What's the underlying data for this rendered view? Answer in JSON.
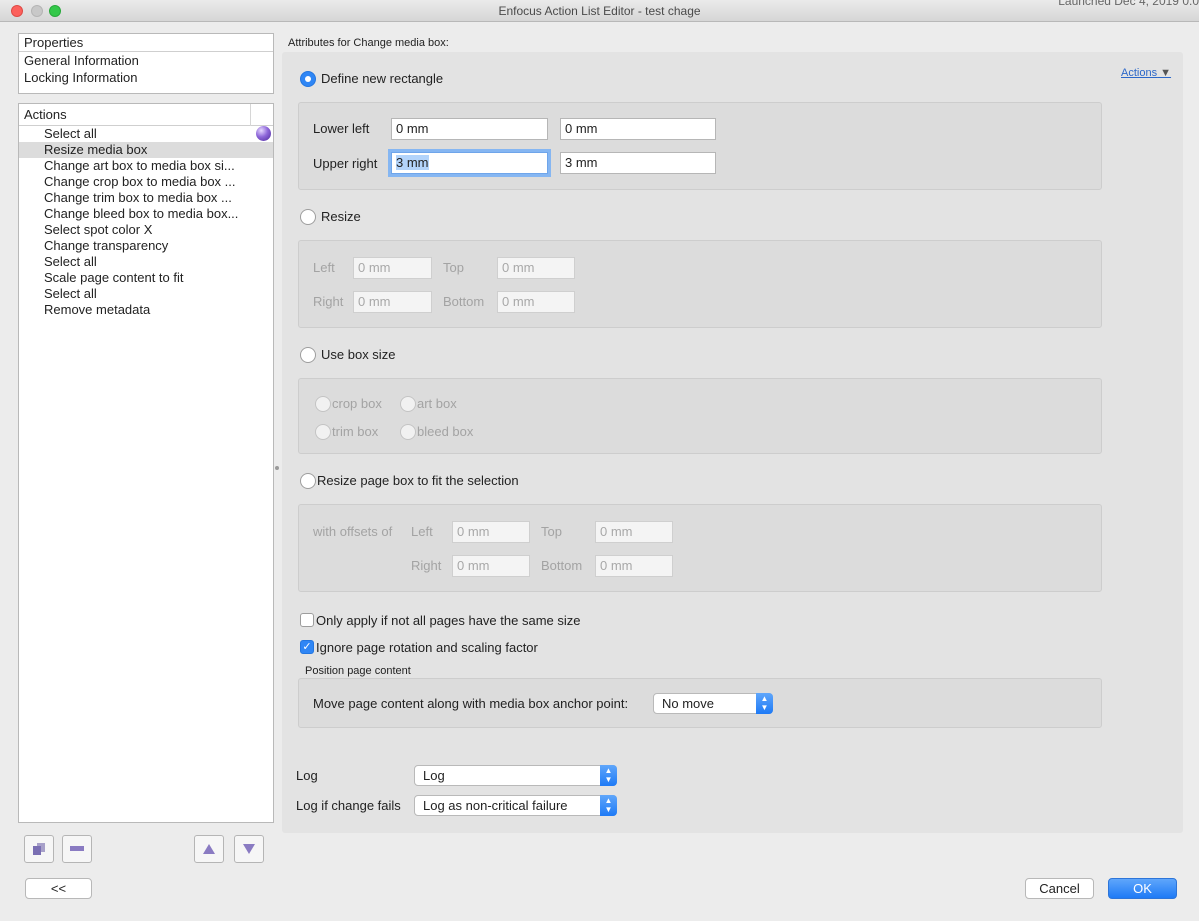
{
  "window": {
    "title": "Enfocus Action List Editor - test chage",
    "behind_text": "Launched Dec 4, 2019 0:0"
  },
  "properties": {
    "header": "Properties",
    "items": [
      "General Information",
      "Locking Information"
    ]
  },
  "actions_list": {
    "header": "Actions",
    "items": [
      "Select all",
      "Resize media box",
      "Change art box to media box si...",
      "Change crop box to media box ...",
      "Change trim box to media box ...",
      "Change bleed box to media box...",
      "Select spot color X",
      "Change transparency",
      "Select all",
      "Scale page content to fit",
      "Select all",
      "Remove metadata"
    ],
    "selected_index": 1
  },
  "toolbar": {
    "add_icon": "add-action-icon",
    "remove_icon": "remove-action-icon",
    "up_icon": "move-up-icon",
    "down_icon": "move-down-icon"
  },
  "attributes": {
    "title": "Attributes for Change media box:",
    "actions_menu": "Actions",
    "define_new_rectangle": {
      "label": "Define new rectangle",
      "lower_left_label": "Lower left",
      "lower_left_x": "0 mm",
      "lower_left_y": "0 mm",
      "upper_right_label": "Upper right",
      "upper_right_x": "3 mm",
      "upper_right_y": "3 mm"
    },
    "resize": {
      "label": "Resize",
      "left_label": "Left",
      "left": "0 mm",
      "top_label": "Top",
      "top": "0 mm",
      "right_label": "Right",
      "right": "0 mm",
      "bottom_label": "Bottom",
      "bottom": "0 mm"
    },
    "use_box_size": {
      "label": "Use box size",
      "crop_box": "crop box",
      "art_box": "art box",
      "trim_box": "trim box",
      "bleed_box": "bleed box"
    },
    "fit_selection": {
      "label": "Resize page box to fit the selection",
      "with_offsets_label": "with offsets of",
      "left_label": "Left",
      "left": "0 mm",
      "top_label": "Top",
      "top": "0 mm",
      "right_label": "Right",
      "right": "0 mm",
      "bottom_label": "Bottom",
      "bottom": "0 mm"
    },
    "only_apply_label": "Only apply if not all pages have the same size",
    "ignore_rotation_label": "Ignore page rotation and scaling factor",
    "position_heading": "Position page content",
    "move_content_label": "Move page content along with media box anchor point:",
    "move_content_value": "No move",
    "log_label": "Log",
    "log_value": "Log",
    "log_fail_label": "Log if change fails",
    "log_fail_value": "Log as non-critical failure"
  },
  "footer": {
    "collapse_label": "<<",
    "cancel_label": "Cancel",
    "ok_label": "OK"
  },
  "colors": {
    "accent": "#1e7af6",
    "selection": "#dcdcdc"
  }
}
